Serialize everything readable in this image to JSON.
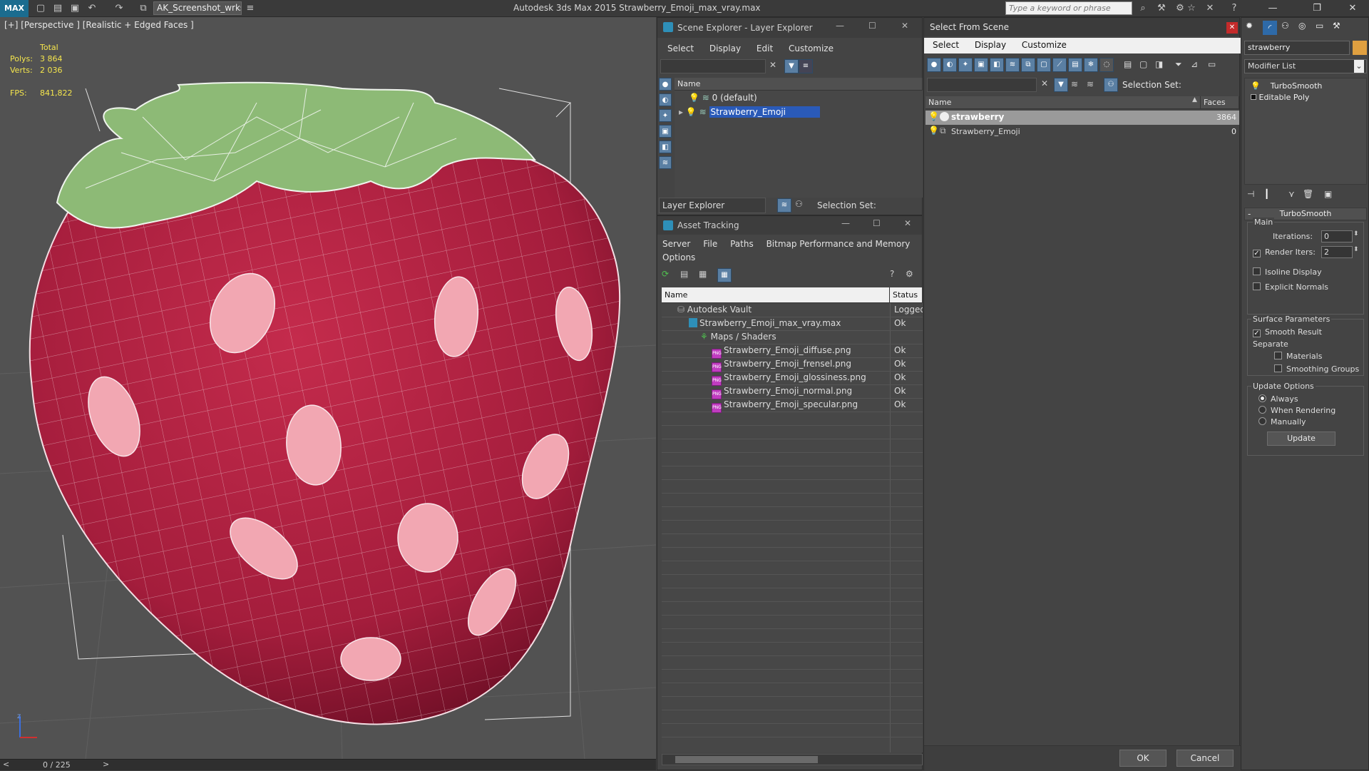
{
  "titlebar": {
    "logo": "MAX",
    "workspace": "AK_Screenshot_wrksp",
    "app_title": "Autodesk 3ds Max  2015     Strawberry_Emoji_max_vray.max",
    "search_placeholder": "Type a keyword or phrase"
  },
  "viewport": {
    "label": "[+] [Perspective ] [Realistic + Edged Faces ]",
    "stats": {
      "total_label": "Total",
      "polys_label": "Polys:",
      "polys_value": "3 864",
      "verts_label": "Verts:",
      "verts_value": "2 036",
      "fps_label": "FPS:",
      "fps_value": "841,822"
    },
    "axis_label": "z",
    "timeline": "0 / 225"
  },
  "scene_explorer": {
    "title": "Scene Explorer - Layer Explorer",
    "menu": [
      "Select",
      "Display",
      "Edit",
      "Customize"
    ],
    "column": "Name",
    "rows": [
      {
        "name": "0 (default)",
        "selected": false
      },
      {
        "name": "Strawberry_Emoji",
        "selected": true
      }
    ],
    "footer_dropdown": "Layer Explorer",
    "footer_selection": "Selection Set:"
  },
  "asset_tracking": {
    "title": "Asset Tracking",
    "menu": [
      "Server",
      "File",
      "Paths",
      "Bitmap Performance and Memory"
    ],
    "menu2": "Options",
    "col_name": "Name",
    "col_status": "Status",
    "rows": [
      {
        "name": "Autodesk Vault",
        "status": "Logged",
        "indent": 0,
        "icon": "vault"
      },
      {
        "name": "Strawberry_Emoji_max_vray.max",
        "status": "Ok",
        "indent": 1,
        "icon": "max"
      },
      {
        "name": "Maps / Shaders",
        "status": "",
        "indent": 2,
        "icon": "maps"
      },
      {
        "name": "Strawberry_Emoji_diffuse.png",
        "status": "Ok",
        "indent": 3,
        "icon": "png"
      },
      {
        "name": "Strawberry_Emoji_frensel.png",
        "status": "Ok",
        "indent": 3,
        "icon": "png"
      },
      {
        "name": "Strawberry_Emoji_glossiness.png",
        "status": "Ok",
        "indent": 3,
        "icon": "png"
      },
      {
        "name": "Strawberry_Emoji_normal.png",
        "status": "Ok",
        "indent": 3,
        "icon": "png"
      },
      {
        "name": "Strawberry_Emoji_specular.png",
        "status": "Ok",
        "indent": 3,
        "icon": "png"
      }
    ],
    "png_label": "PNG"
  },
  "select_from_scene": {
    "title": "Select From Scene",
    "menu": [
      "Select",
      "Display",
      "Customize"
    ],
    "selection_set": "Selection Set:",
    "col_name": "Name",
    "col_faces": "Faces",
    "rows": [
      {
        "name": "strawberry",
        "faces": "3864",
        "selected": true
      },
      {
        "name": "Strawberry_Emoji",
        "faces": "0",
        "selected": false
      }
    ],
    "ok": "OK",
    "cancel": "Cancel"
  },
  "modify_panel": {
    "object_name": "strawberry",
    "modifier_list": "Modifier List",
    "stack": [
      "TurboSmooth",
      "Editable Poly"
    ],
    "rollout_title": "TurboSmooth",
    "main_label": "Main",
    "iterations_label": "Iterations:",
    "iterations_value": "0",
    "render_iters_label": "Render Iters:",
    "render_iters_value": "2",
    "isoline_display": "Isoline Display",
    "explicit_normals": "Explicit Normals",
    "surface_params": "Surface Parameters",
    "smooth_result": "Smooth Result",
    "separate": "Separate",
    "materials": "Materials",
    "smoothing_groups": "Smoothing Groups",
    "update_options": "Update Options",
    "always": "Always",
    "when_rendering": "When Rendering",
    "manually": "Manually",
    "update_button": "Update"
  },
  "colors": {
    "strawberry": "#a41d3c",
    "leaf": "#8dba76",
    "seed": "#f2a7b2",
    "selection": "#2a5ab8",
    "stats": "#f5e64d"
  }
}
